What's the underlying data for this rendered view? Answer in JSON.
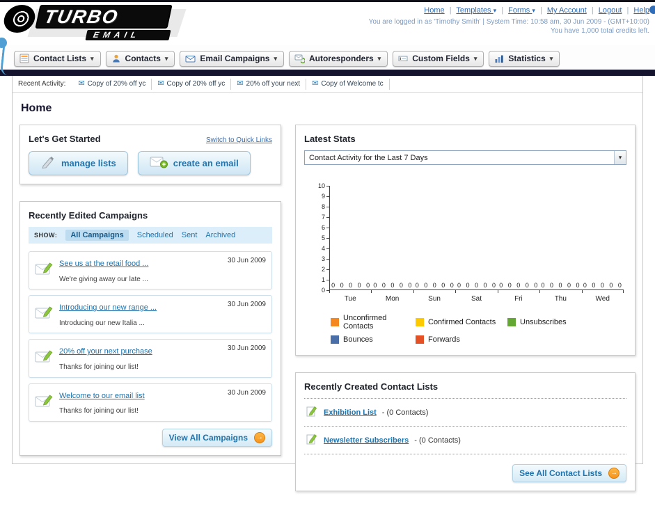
{
  "icons": {
    "dropdown_arrow": "▾",
    "envelope": "✉",
    "pencil": "✎",
    "arrow_right": "→"
  },
  "header": {
    "logo_line1": "TURBO",
    "logo_line2": "EMAIL",
    "link_separator": "|",
    "links": [
      {
        "label": "Home"
      },
      {
        "label": "Templates"
      },
      {
        "label": "Forms"
      },
      {
        "label": "My Account"
      },
      {
        "label": "Logout"
      },
      {
        "label": "Help"
      }
    ],
    "login_info": "You are logged in as 'Timothy Smith' | System Time: 10:58 am, 30 Jun 2009 - (GMT+10:00)",
    "credits_info": "You have 1,000 total credits left."
  },
  "nav": {
    "tabs": [
      {
        "label": "Contact Lists"
      },
      {
        "label": "Contacts"
      },
      {
        "label": "Email Campaigns"
      },
      {
        "label": "Autoresponders"
      },
      {
        "label": "Custom Fields"
      },
      {
        "label": "Statistics"
      }
    ]
  },
  "recent_activity": {
    "label": "Recent Activity:",
    "items": [
      {
        "text": "Copy of 20% off yc"
      },
      {
        "text": "Copy of 20% off yc"
      },
      {
        "text": "20% off your next"
      },
      {
        "text": "Copy of Welcome tc"
      }
    ]
  },
  "page": {
    "title": "Home"
  },
  "get_started": {
    "title": "Let's Get Started",
    "switch_link": "Switch to Quick Links",
    "manage_lists_label": "manage lists",
    "create_email_label": "create an email"
  },
  "campaigns": {
    "title": "Recently Edited Campaigns",
    "show_label": "SHOW:",
    "filters": [
      {
        "label": "All Campaigns",
        "active": true
      },
      {
        "label": "Scheduled",
        "active": false
      },
      {
        "label": "Sent",
        "active": false
      },
      {
        "label": "Archived",
        "active": false
      }
    ],
    "items": [
      {
        "title": "See us at the retail food ...",
        "subtitle": "We're giving away our late ...",
        "date": "30 Jun 2009"
      },
      {
        "title": "Introducing our new range ...",
        "subtitle": "Introducing our new Italia ...",
        "date": "30 Jun 2009"
      },
      {
        "title": "20% off your next purchase",
        "subtitle": "Thanks for joining our list!",
        "date": "30 Jun 2009"
      },
      {
        "title": "Welcome to our email list",
        "subtitle": "Thanks for joining our list!",
        "date": "30 Jun 2009"
      }
    ],
    "view_all_label": "View All Campaigns"
  },
  "stats": {
    "title": "Latest Stats",
    "filter_value": "Contact Activity for the Last 7 Days",
    "chart_data": {
      "type": "bar",
      "title": "Contact Activity for the Last 7 Days",
      "categories": [
        "Tue",
        "Mon",
        "Sun",
        "Sat",
        "Fri",
        "Thu",
        "Wed"
      ],
      "series": [
        {
          "name": "Unconfirmed Contacts",
          "color": "#f5871f",
          "values": [
            0,
            0,
            0,
            0,
            0,
            0,
            0
          ]
        },
        {
          "name": "Confirmed Contacts",
          "color": "#fdca01",
          "values": [
            0,
            0,
            0,
            0,
            0,
            0,
            0
          ]
        },
        {
          "name": "Unsubscribes",
          "color": "#64a833",
          "values": [
            0,
            0,
            0,
            0,
            0,
            0,
            0
          ]
        },
        {
          "name": "Bounces",
          "color": "#4a6fa8",
          "values": [
            0,
            0,
            0,
            0,
            0,
            0,
            0
          ]
        },
        {
          "name": "Forwards",
          "color": "#e45126",
          "values": [
            0,
            0,
            0,
            0,
            0,
            0,
            0
          ]
        }
      ],
      "ylim": [
        0,
        10
      ],
      "y_ticks": [
        10,
        9,
        8,
        7,
        6,
        5,
        4,
        3,
        2,
        1,
        0
      ],
      "grid": false,
      "legend_position": "bottom"
    }
  },
  "contact_lists": {
    "title": "Recently Created Contact Lists",
    "items": [
      {
        "name": "Exhibition List",
        "count": "- (0 Contacts)"
      },
      {
        "name": "Newsletter Subscribers",
        "count": "- (0 Contacts)"
      }
    ],
    "see_all_label": "See All Contact Lists"
  }
}
